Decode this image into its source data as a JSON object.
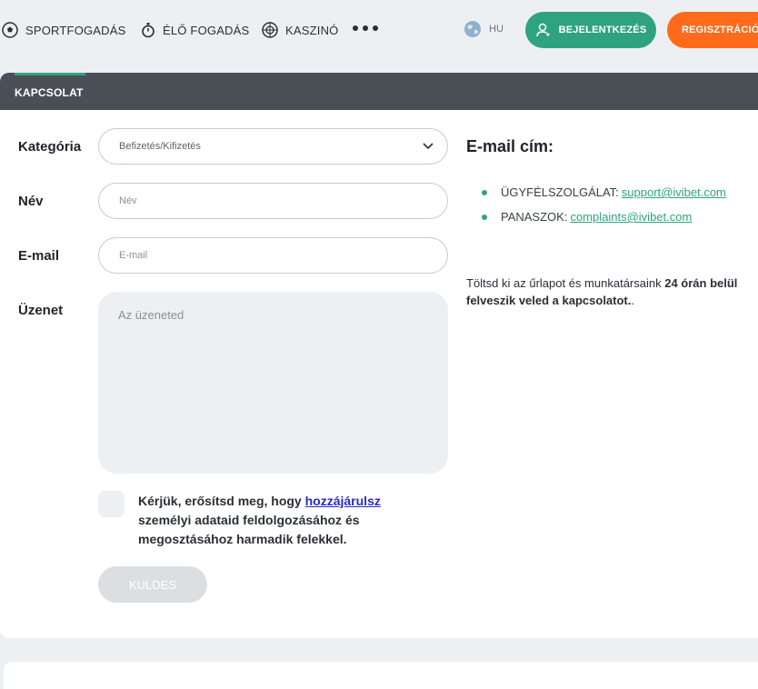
{
  "nav": {
    "items": [
      {
        "label": "SPORTFOGADÁS",
        "icon": "soccer-ball-icon"
      },
      {
        "label": "ÉLŐ FOGADÁS",
        "icon": "stopwatch-icon"
      },
      {
        "label": "KASZINÓ",
        "icon": "roulette-icon"
      }
    ],
    "more_icon": "more-dots-icon",
    "language": "HU",
    "login_label": "BEJELENTKEZÉS",
    "register_label": "REGISZTRÁCIÓ"
  },
  "card": {
    "tab_label": "KAPCSOLAT"
  },
  "form": {
    "category": {
      "label": "Kategória",
      "value": "Befizetés/Kifizetés"
    },
    "name": {
      "label": "Név",
      "placeholder": "Név"
    },
    "email": {
      "label": "E-mail",
      "placeholder": "E-mail"
    },
    "message": {
      "label": "Üzenet",
      "placeholder": "Az üzeneted"
    },
    "consent": {
      "text_before": "Kérjük, erősítsd meg, hogy ",
      "link": "hozzájárulsz",
      "text_after": " személyi adataid feldolgozásához és megosztásához harmadik felekkel."
    },
    "submit_label": "KULDES"
  },
  "contact": {
    "title": "E-mail cím:",
    "support_label": "ÜGYFÉLSZOLGÁLAT:",
    "support_email": "support@ivibet.com",
    "complaints_label": "PANASZOK:",
    "complaints_email": "complaints@ivibet.com",
    "info_before": "Töltsd ki az űrlapot és munkatársaink ",
    "info_bold": "24 órán belül felveszik veled a kapcsolatot.",
    "info_after": "."
  },
  "colors": {
    "accent": "#2fa37e",
    "register": "#ff6b1a",
    "header": "#4a4f56",
    "link": "#2a29c7"
  }
}
